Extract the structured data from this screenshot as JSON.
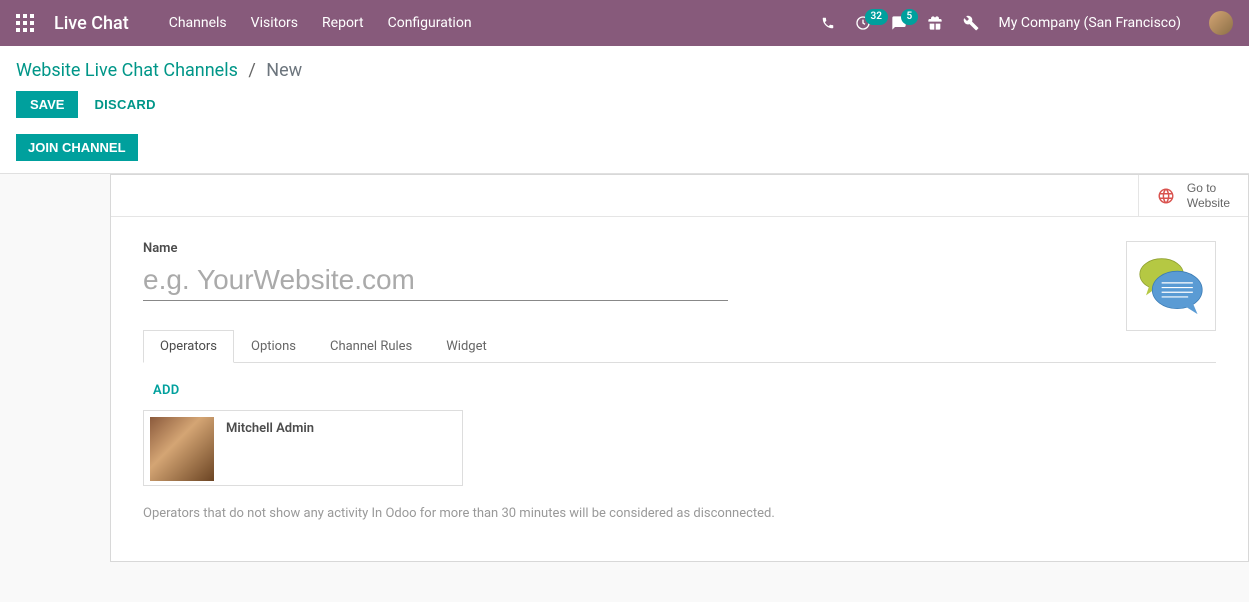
{
  "navbar": {
    "app_title": "Live Chat",
    "menu": [
      "Channels",
      "Visitors",
      "Report",
      "Configuration"
    ],
    "clock_badge": "32",
    "message_badge": "5",
    "company": "My Company (San Francisco)"
  },
  "breadcrumb": {
    "root": "Website Live Chat Channels",
    "sep": "/",
    "current": "New"
  },
  "buttons": {
    "save": "SAVE",
    "discard": "DISCARD",
    "join": "JOIN CHANNEL",
    "goto_website_line1": "Go to",
    "goto_website_line2": "Website",
    "add": "ADD"
  },
  "form": {
    "name_label": "Name",
    "name_placeholder": "e.g. YourWebsite.com",
    "name_value": ""
  },
  "tabs": [
    "Operators",
    "Options",
    "Channel Rules",
    "Widget"
  ],
  "operators": [
    {
      "name": "Mitchell Admin"
    }
  ],
  "help_text": "Operators that do not show any activity In Odoo for more than 30 minutes will be considered as disconnected.",
  "icons": {
    "apps": "apps-icon",
    "phone": "phone-icon",
    "clock": "clock-icon",
    "message": "message-icon",
    "gift": "gift-icon",
    "wrench": "wrench-icon",
    "globe": "globe-icon",
    "chat": "chat-image"
  }
}
